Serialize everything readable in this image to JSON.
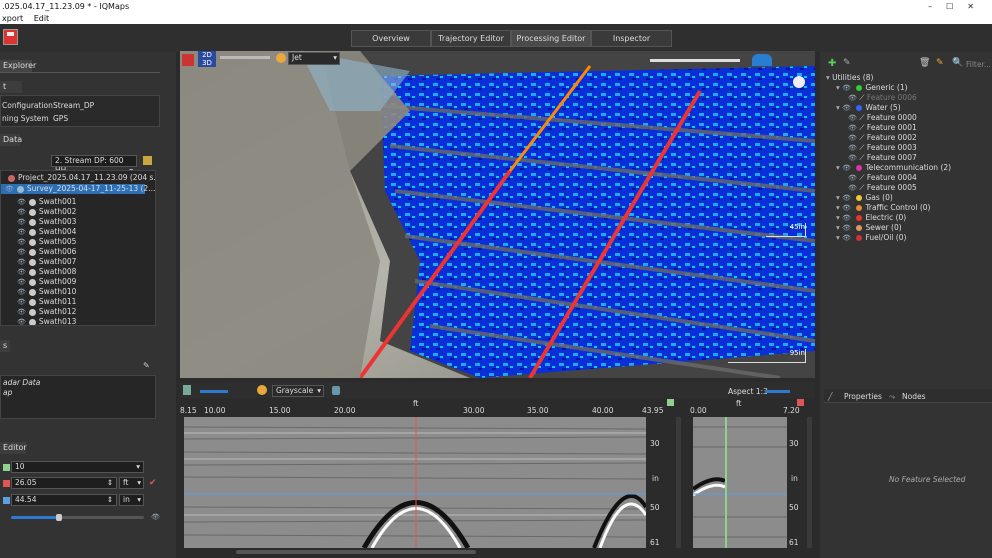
{
  "window": {
    "title": ".025.04.17_11.23.09 * - IQMaps"
  },
  "menu": [
    "xport",
    "Edit"
  ],
  "toolbar": {
    "tabs": [
      "Overview",
      "Trajectory Editor",
      "Processing Editor",
      "Inspector"
    ]
  },
  "explorer": {
    "tab": "Explorer",
    "project_info_header": "t Info",
    "config_label": "Configuration",
    "config_value": "Stream_DP",
    "positioning_label": "ning System",
    "positioning_value": "GPS",
    "data_header": "Data",
    "stream_select": "2. Stream DP: 600 HH",
    "project_node": "Project_2025.04.17_11.23.09 (204 s...",
    "survey_node": "Survey_2025-04-17_11-25-13 (2...",
    "swaths": [
      "Swath001",
      "Swath002",
      "Swath003",
      "Swath004",
      "Swath005",
      "Swath006",
      "Swath007",
      "Swath008",
      "Swath009",
      "Swath010",
      "Swath011",
      "Swath012",
      "Swath013"
    ]
  },
  "layers": {
    "header": "s",
    "items": [
      "adar Data",
      "ap"
    ]
  },
  "editor": {
    "header": "Editor",
    "row1_value": "10",
    "row2_value": "26.05",
    "row2_unit": "ft",
    "row3_value": "44.54",
    "row3_unit": "in",
    "colors": {
      "row1": "#8fd18f",
      "row2": "#e05555",
      "row3": "#5aa0e0"
    },
    "slider_fraction": 0.36
  },
  "scene": {
    "view_2d": "2D",
    "view_3d": "3D",
    "colormap": "Jet",
    "scale_label_1": "45in",
    "scale_label_2": "95in"
  },
  "radar": {
    "colormap": "Grayscale",
    "aspect": "Aspect 1:3",
    "x_unit": "ft",
    "x_ticks": [
      "8.15",
      "10.00",
      "15.00",
      "20.00",
      "30.00",
      "35.00",
      "40.00",
      "43.95"
    ],
    "right_x_ticks": [
      "0.00",
      "7.20"
    ],
    "right_x_unit": "ft",
    "y_ticks": [
      "30",
      "in",
      "50",
      "61"
    ]
  },
  "utilities": {
    "root": "Utilities (8)",
    "items": [
      {
        "label": "Generic (1)",
        "level": 1,
        "icon": "green-circle"
      },
      {
        "label": "Feature 0006",
        "level": 2,
        "dim": true
      },
      {
        "label": "Water (5)",
        "level": 1,
        "icon": "blue-dot"
      },
      {
        "label": "Feature 0000",
        "level": 2
      },
      {
        "label": "Feature 0001",
        "level": 2
      },
      {
        "label": "Feature 0002",
        "level": 2
      },
      {
        "label": "Feature 0003",
        "level": 2
      },
      {
        "label": "Feature 0007",
        "level": 2
      },
      {
        "label": "Telecommunication (2)",
        "level": 1,
        "icon": "magenta-dot"
      },
      {
        "label": "Feature 0004",
        "level": 2
      },
      {
        "label": "Feature 0005",
        "level": 2
      },
      {
        "label": "Gas (0)",
        "level": 1,
        "icon": "yellow-square"
      },
      {
        "label": "Traffic Control (0)",
        "level": 1,
        "icon": "orange-bolt"
      },
      {
        "label": "Electric (0)",
        "level": 1,
        "icon": "red-bolt"
      },
      {
        "label": "Sewer (0)",
        "level": 1,
        "icon": "tan-circle"
      },
      {
        "label": "Fuel/Oil (0)",
        "level": 1,
        "icon": "red-square"
      }
    ],
    "filter_placeholder": "Filter..."
  },
  "properties": {
    "tab_properties": "Properties",
    "tab_nodes": "Nodes",
    "empty_text": "No Feature Selected"
  }
}
